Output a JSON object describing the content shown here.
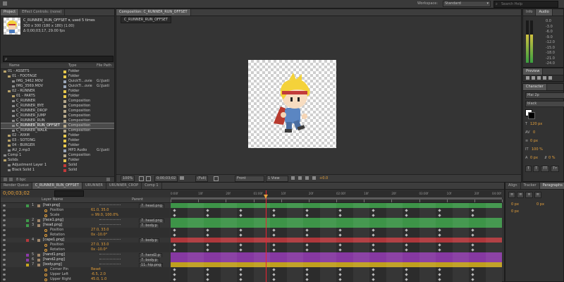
{
  "menubar": {
    "workspace_label": "Workspace:",
    "workspace_value": "Standard",
    "search_placeholder": "Search Help"
  },
  "project_panel": {
    "tabs": [
      "Project",
      "Effect Controls: (none)"
    ],
    "preview_name": "C_RUNNER_RUN_OFFSET ▾, used 5 times",
    "preview_info1": "300 x 300  (180 x 180) (1.00)",
    "preview_info2": "Δ 0;00;03;17, 29.00 fps",
    "search_placeholder": "ρ",
    "columns": [
      "Name",
      "Type",
      "File Path"
    ],
    "items": [
      {
        "name": "01 - ASSETS",
        "type": "Folder",
        "path": "",
        "color": "#e7c84b",
        "indent": 0
      },
      {
        "name": "01 - FOOTAGE",
        "type": "Folder",
        "path": "",
        "color": "#e7c84b",
        "indent": 1
      },
      {
        "name": "IMG_3462.MOV",
        "type": "QuickTi...ovie",
        "path": "G:\\Justi",
        "color": "#9aa6b8",
        "indent": 2
      },
      {
        "name": "IMG_3569.MOV",
        "type": "QuickTi...ovie",
        "path": "G:\\Justi",
        "color": "#9aa6b8",
        "indent": 2
      },
      {
        "name": "02 - RUNNER",
        "type": "Folder",
        "path": "",
        "color": "#e7c84b",
        "indent": 1
      },
      {
        "name": "01 - PARTS",
        "type": "Folder",
        "path": "",
        "color": "#e7c84b",
        "indent": 2
      },
      {
        "name": "C_RUNNER",
        "type": "Composition",
        "path": "",
        "color": "#b6a88a",
        "indent": 2
      },
      {
        "name": "C_RUNNER_BYE",
        "type": "Composition",
        "path": "",
        "color": "#b6a88a",
        "indent": 2
      },
      {
        "name": "C_RUNNER_DROP",
        "type": "Composition",
        "path": "",
        "color": "#b6a88a",
        "indent": 2
      },
      {
        "name": "C_RUNNER_JUMP",
        "type": "Composition",
        "path": "",
        "color": "#b6a88a",
        "indent": 2
      },
      {
        "name": "C_RUNNER_RUN",
        "type": "Composition",
        "path": "",
        "color": "#b6a88a",
        "indent": 2
      },
      {
        "name": "C_RUNNER_RUN_OFFSET",
        "type": "Composition",
        "path": "",
        "color": "#b6a88a",
        "indent": 2,
        "selected": true
      },
      {
        "name": "C_RUNNER_WALK",
        "type": "Composition",
        "path": "",
        "color": "#b6a88a",
        "indent": 2
      },
      {
        "name": "02 - AYAM",
        "type": "Folder",
        "path": "",
        "color": "#e7c84b",
        "indent": 1
      },
      {
        "name": "03 - SOTONG",
        "type": "Folder",
        "path": "",
        "color": "#e7c84b",
        "indent": 1
      },
      {
        "name": "04 - BURGER",
        "type": "Folder",
        "path": "",
        "color": "#e7c84b",
        "indent": 1
      },
      {
        "name": "AU_2.mp3",
        "type": "MP3 Audio",
        "path": "G:\\Justi",
        "color": "#9aa6b8",
        "indent": 1
      },
      {
        "name": "Comp 1",
        "type": "Composition",
        "path": "",
        "color": "#b6a88a",
        "indent": 0
      },
      {
        "name": "Solids",
        "type": "Folder",
        "path": "",
        "color": "#e7c84b",
        "indent": 0
      },
      {
        "name": "Adjustment Layer 1",
        "type": "Solid",
        "path": "",
        "color": "#c23a3a",
        "indent": 1
      },
      {
        "name": "Black Solid 1",
        "type": "Solid",
        "path": "",
        "color": "#c23a3a",
        "indent": 1
      }
    ],
    "footer_bpc": "8 bpc"
  },
  "composition_panel": {
    "title": "Composition: C_RUNNER_RUN_OFFSET",
    "tab": "C_RUNNER_RUN_OFFSET",
    "zoom": "100%",
    "timecode": "0;00;03;02",
    "resolution": "(Full)",
    "view": "Front",
    "views": "1 View",
    "exposure": "+0.0"
  },
  "right_panels": {
    "info_tabs": [
      "Info",
      "Audio"
    ],
    "audio_levels": [
      "0.0",
      "-3.0",
      "-6.0",
      "-9.0",
      "-12.0",
      "-15.0",
      "-18.0",
      "-21.0",
      "-24.0"
    ],
    "preview_tab": "Preview",
    "character_tab": "Character",
    "font": "Mai 2p",
    "color_text": "black",
    "font_size": "120 px",
    "tracking": "0",
    "indent": "0 px",
    "scale": "100 %",
    "leading": "0 px",
    "stroke": "0 %",
    "bottom_tabs": [
      "Align",
      "Tracker",
      "Paragraphs"
    ],
    "para_fields": [
      "0 px",
      "0 px",
      "0 px"
    ]
  },
  "timeline": {
    "tabs": [
      "Render Queue",
      "C_RUNNER_RUN_OFFSET",
      "URUNNER",
      "URUNNER_CROP",
      "Comp 1"
    ],
    "current_time": "0;00;03;02",
    "columns": [
      "Layer Name",
      "Parent"
    ],
    "ruler_labels": [
      "0:00f",
      "10f",
      "20f",
      "01:00f",
      "10f",
      "20f",
      "02:00f",
      "10f",
      "20f",
      "03:00f",
      "10f",
      "20f",
      "04:00f"
    ],
    "layers": [
      {
        "num": "1",
        "name": "[hair.png]",
        "parent": "7. head.png",
        "bar": "#3f9a4a",
        "type": "layer"
      },
      {
        "name": "Position",
        "value": "61.0, 35.0",
        "type": "prop"
      },
      {
        "name": "Scale",
        "value": "∞ 99.0, 100.0%",
        "type": "prop"
      },
      {
        "num": "2",
        "name": "[face1.png]",
        "parent": "7. head.png",
        "bar": "#3f9a4a",
        "type": "layer"
      },
      {
        "num": "3",
        "name": "[head.png]",
        "parent": "7. body.p",
        "bar": "#3f9a4a",
        "type": "layer"
      },
      {
        "name": "Position",
        "value": "27.0, 33.0",
        "type": "prop"
      },
      {
        "name": "Rotation",
        "value": "0x -10.0°",
        "type": "prop"
      },
      {
        "num": "4",
        "name": "[cape1.png]",
        "parent": "7. body.p",
        "bar": "#b6383c",
        "type": "layer"
      },
      {
        "name": "Position",
        "value": "27.0, 33.0",
        "type": "prop"
      },
      {
        "name": "Rotation",
        "value": "0x -10.0°",
        "type": "prop"
      },
      {
        "num": "5",
        "name": "[hand1.png]",
        "parent": "7. hand2.p",
        "bar": "#8b3aa8",
        "type": "layer"
      },
      {
        "num": "6",
        "name": "[hand2.png]",
        "parent": "7. body.p",
        "bar": "#8b3aa8",
        "type": "layer"
      },
      {
        "num": "7",
        "name": "[body.png]",
        "parent": "11. hip.png",
        "bar": "#c8a61e",
        "type": "layer"
      },
      {
        "name": "Corner Pin",
        "value": "Reset",
        "type": "prop"
      },
      {
        "name": "Upper Left",
        "value": "-6.5, 2.0",
        "type": "prop"
      },
      {
        "name": "Upper Right",
        "value": "45.0, 1.0",
        "type": "prop"
      }
    ]
  }
}
